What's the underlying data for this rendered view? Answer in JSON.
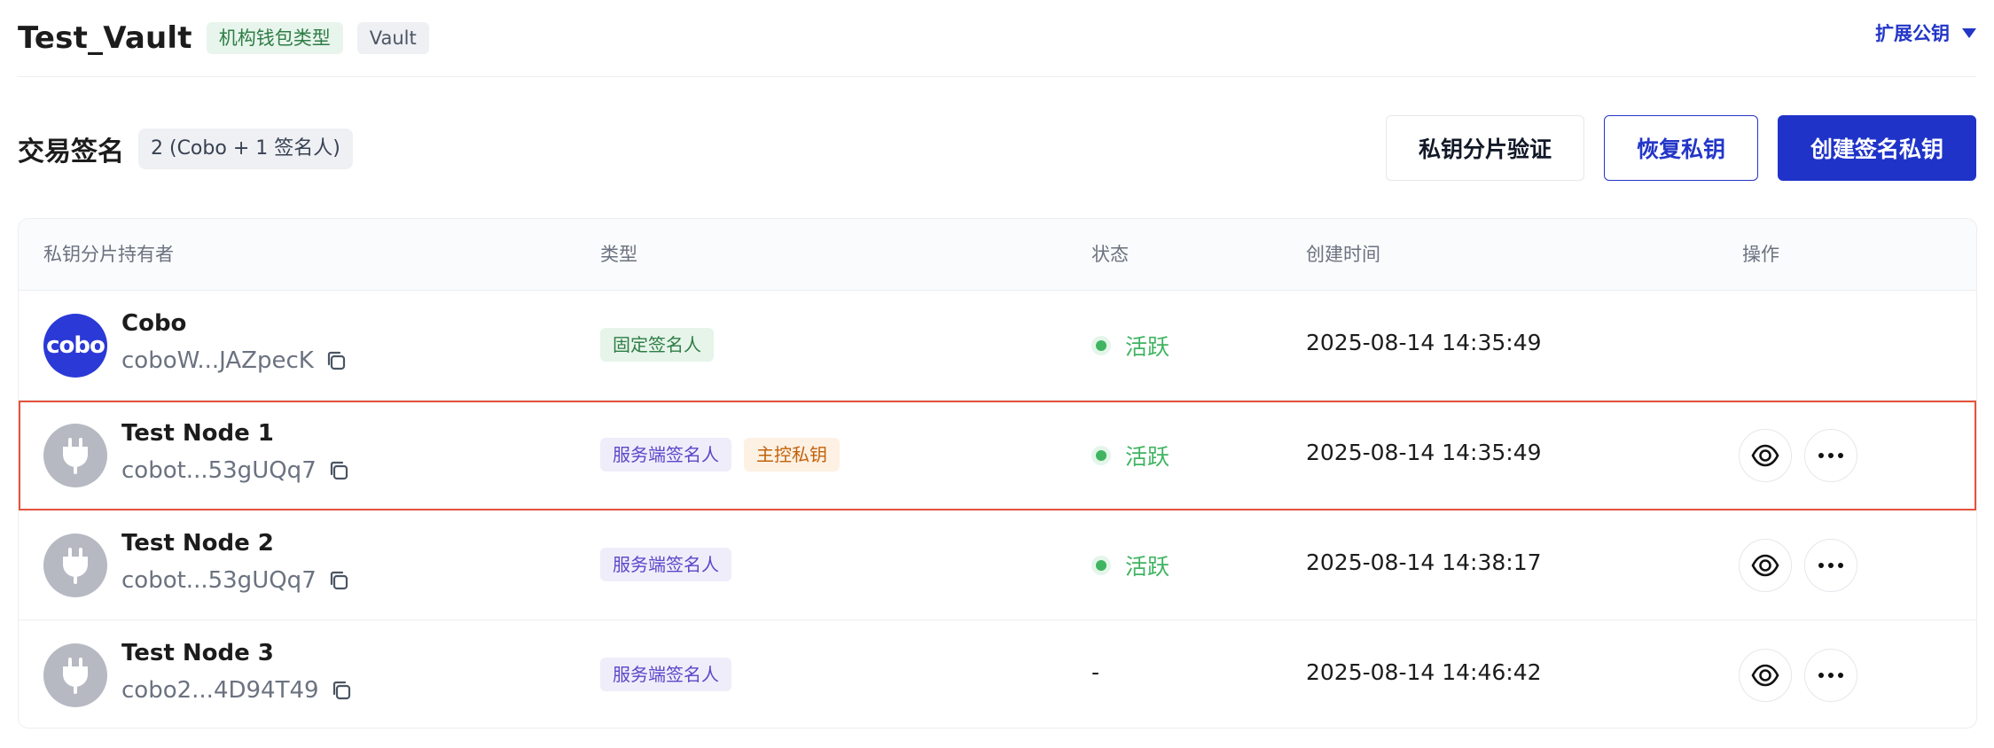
{
  "header": {
    "title": "Test_Vault",
    "tag_wallet_type": "机构钱包类型",
    "tag_vault": "Vault",
    "extended_pubkey_label": "扩展公钥"
  },
  "section": {
    "title": "交易签名",
    "signer_count": "2 (Cobo + 1 签名人)",
    "btn_verify": "私钥分片验证",
    "btn_recover": "恢复私钥",
    "btn_create": "创建签名私钥"
  },
  "table": {
    "headers": {
      "holder": "私钥分片持有者",
      "type": "类型",
      "status": "状态",
      "created": "创建时间",
      "actions": "操作"
    },
    "rows": [
      {
        "name": "Cobo",
        "address": "coboW...JAZpecK",
        "types": [
          "固定签名人"
        ],
        "status": "活跃",
        "created": "2025-08-14 14:35:49"
      },
      {
        "name": "Test Node 1",
        "address": "cobot...53gUQq7",
        "types": [
          "服务端签名人",
          "主控私钥"
        ],
        "status": "活跃",
        "created": "2025-08-14 14:35:49"
      },
      {
        "name": "Test Node 2",
        "address": "cobot...53gUQq7",
        "types": [
          "服务端签名人"
        ],
        "status": "活跃",
        "created": "2025-08-14 14:38:17"
      },
      {
        "name": "Test Node 3",
        "address": "cobo2...4D94T49",
        "types": [
          "服务端签名人"
        ],
        "status": "-",
        "created": "2025-08-14 14:46:42"
      }
    ]
  },
  "avatar_text": "cobo",
  "colors": {
    "primary": "#2033c9",
    "active_green": "#3fb461",
    "highlight_border": "#e5533b"
  }
}
